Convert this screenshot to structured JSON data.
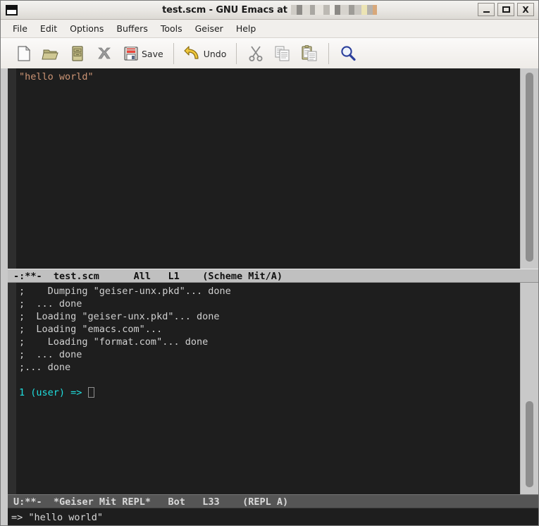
{
  "titlebar": {
    "title_prefix": "test.scm - GNU Emacs at",
    "hostname_redacted": "",
    "window_icon": "window-icon",
    "buttons": {
      "minimize": "_",
      "maximize": "□",
      "close": "X"
    }
  },
  "menubar": {
    "items": [
      {
        "label": "File"
      },
      {
        "label": "Edit"
      },
      {
        "label": "Options"
      },
      {
        "label": "Buffers"
      },
      {
        "label": "Tools"
      },
      {
        "label": "Geiser"
      },
      {
        "label": "Help"
      }
    ]
  },
  "toolbar": {
    "buttons": [
      {
        "name": "new-file-icon",
        "label": ""
      },
      {
        "name": "open-file-icon",
        "label": ""
      },
      {
        "name": "save-as-icon",
        "label": ""
      },
      {
        "name": "close-file-icon",
        "label": ""
      },
      {
        "name": "save-icon",
        "label": "Save"
      },
      {
        "name": "undo-icon",
        "label": "Undo"
      },
      {
        "name": "cut-icon",
        "label": ""
      },
      {
        "name": "copy-icon",
        "label": ""
      },
      {
        "name": "paste-icon",
        "label": ""
      },
      {
        "name": "search-icon",
        "label": ""
      }
    ]
  },
  "editor": {
    "buffer_name": "test.scm",
    "content": "\"hello world\"",
    "modeline": {
      "flags": "-:**-",
      "buffer": "test.scm",
      "position": "All",
      "line": "L1",
      "major_mode": "(Scheme Mit/A)",
      "full": "-:**-  test.scm      All   L1    (Scheme Mit/A)"
    }
  },
  "repl": {
    "buffer_name": "*Geiser Mit REPL*",
    "output_lines": [
      ";    Dumping \"geiser-unx.pkd\"... done",
      ";  ... done",
      ";  Loading \"geiser-unx.pkd\"... done",
      ";  Loading \"emacs.com\"...",
      ";    Loading \"format.com\"... done",
      ";  ... done",
      ";... done"
    ],
    "prompt": "1 (user) =>",
    "input": "",
    "modeline": {
      "flags": "U:**-",
      "buffer": "*Geiser Mit REPL*",
      "position": "Bot",
      "line": "L33",
      "major_mode": "(REPL A)",
      "full": "U:**-  *Geiser Mit REPL*   Bot   L33    (REPL A)"
    }
  },
  "minibuffer": {
    "message": "=> \"hello world\""
  },
  "colors": {
    "background": "#1e1e1e",
    "fringe": "#2e2e2e",
    "foreground": "#d8d8d8",
    "string": "#cd9575",
    "prompt": "#1fdfdf",
    "modeline_active_bg": "#c0c0c0",
    "modeline_inactive_bg": "#555555",
    "frame_border": "#c9c9c9"
  }
}
